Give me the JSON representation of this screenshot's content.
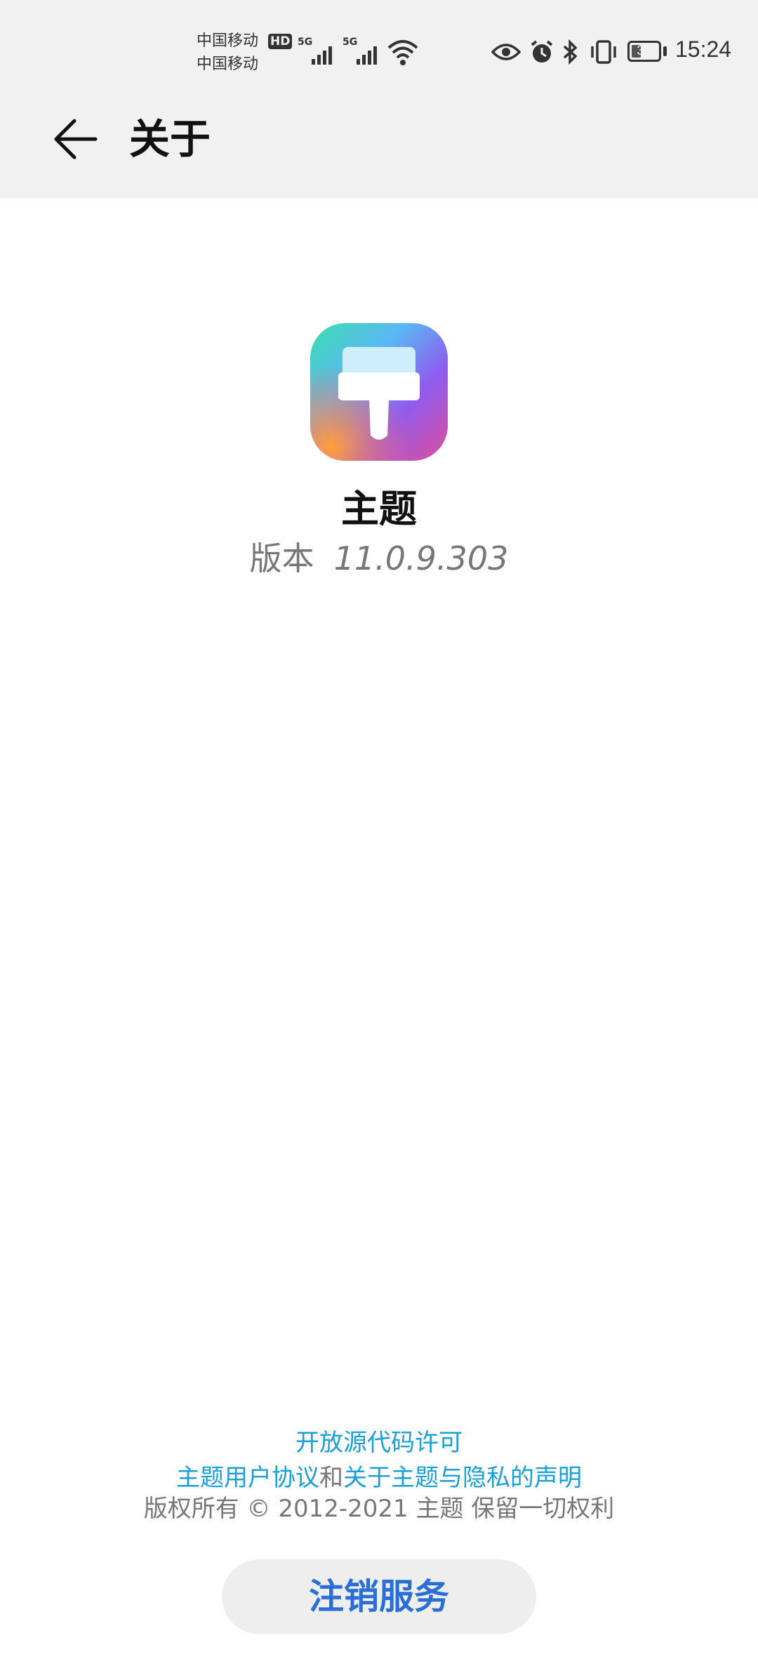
{
  "status_bar": {
    "carrier_1": "中国移动",
    "carrier_2": "中国移动",
    "hd_badge": "HD",
    "signal_1_label": "5G",
    "signal_2_label": "5G",
    "battery_level": "37",
    "time": "15:24",
    "icons": [
      "eye-icon",
      "alarm-icon",
      "bluetooth-icon",
      "vibrate-icon",
      "wifi-icon"
    ]
  },
  "header": {
    "title": "关于",
    "back_icon": "back-arrow-icon"
  },
  "app": {
    "name": "主题",
    "version_label": "版本",
    "version_number": "11.0.9.303",
    "icon": "paintbrush-icon"
  },
  "footer": {
    "open_source_link": "开放源代码许可",
    "user_agreement_link": "主题用户协议",
    "conjunction": "和",
    "privacy_link": "关于主题与隐私的声明",
    "copyright": "版权所有 © 2012-2021 主题 保留一切权利"
  },
  "actions": {
    "deregister_label": "注销服务"
  },
  "colors": {
    "link": "#1aa0d8",
    "button_text": "#2b6fd6",
    "header_bg": "#f1f1f1"
  }
}
